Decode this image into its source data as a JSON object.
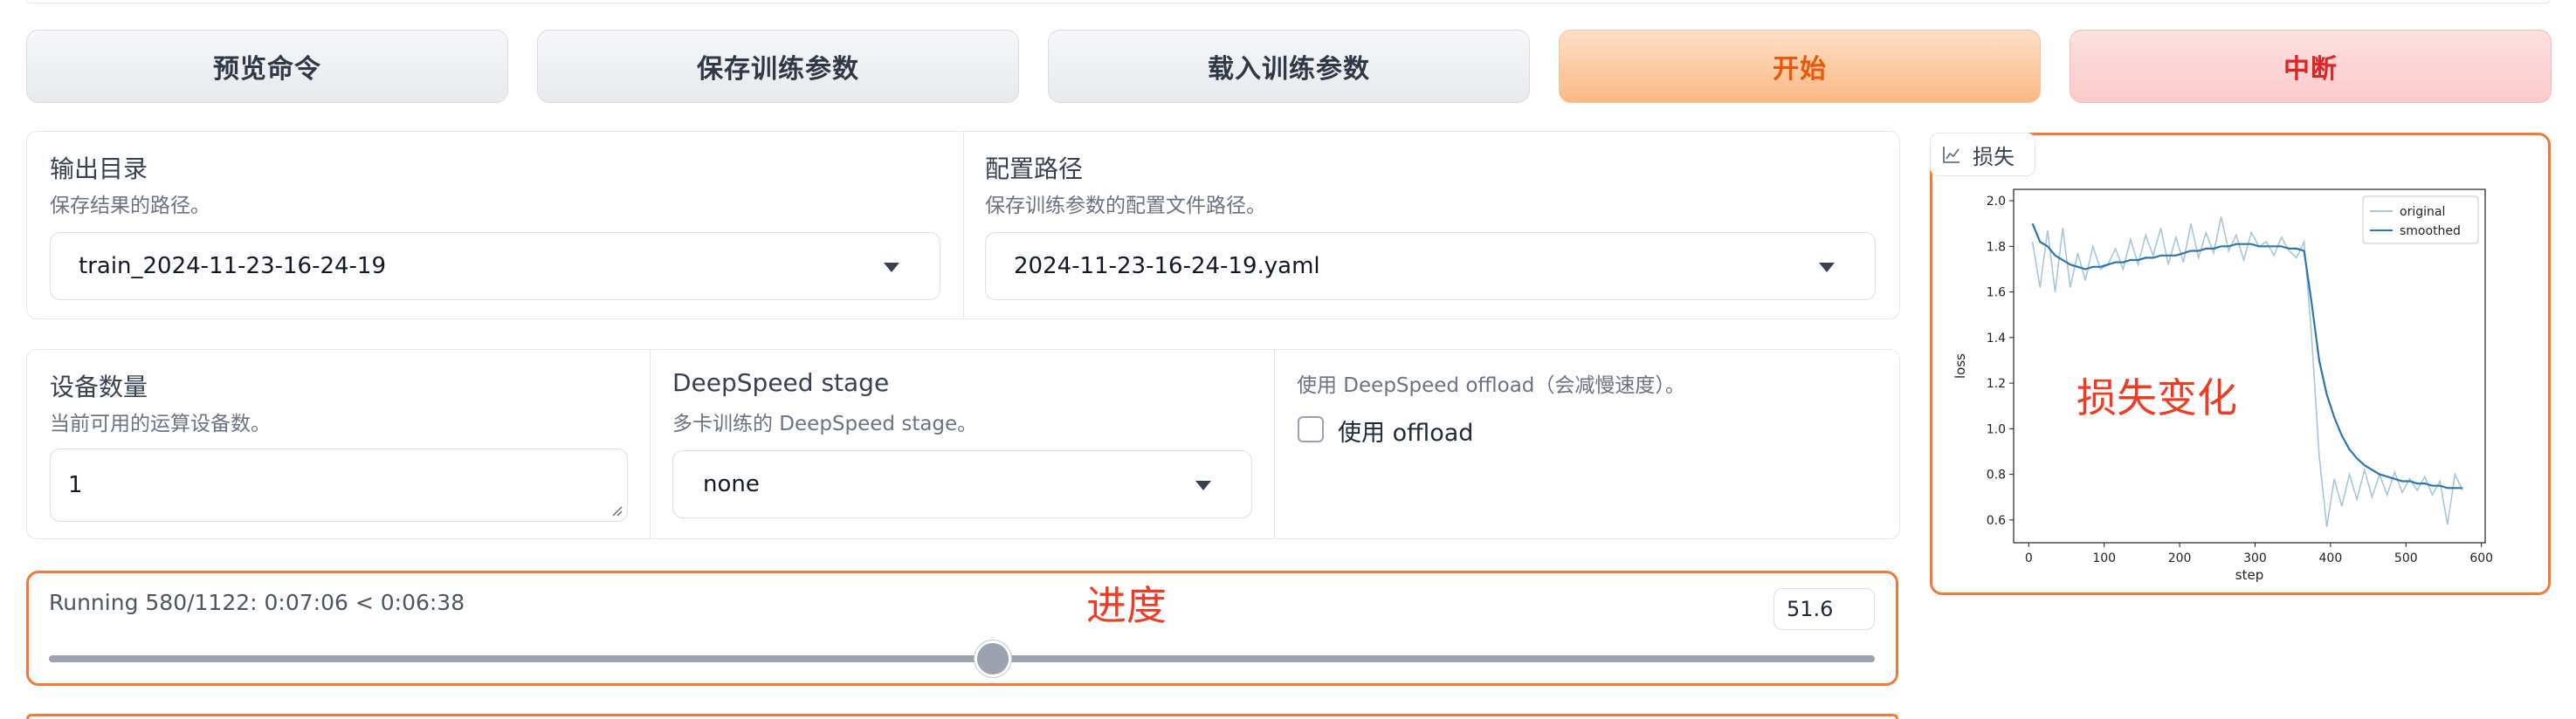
{
  "buttons": {
    "preview": "预览命令",
    "save_args": "保存训练参数",
    "load_args": "载入训练参数",
    "start": "开始",
    "abort": "中断"
  },
  "output_dir": {
    "label": "输出目录",
    "info": "保存结果的路径。",
    "value": "train_2024-11-23-16-24-19"
  },
  "config_path": {
    "label": "配置路径",
    "info": "保存训练参数的配置文件路径。",
    "value": "2024-11-23-16-24-19.yaml"
  },
  "device_count": {
    "label": "设备数量",
    "info": "当前可用的运算设备数。",
    "value": "1"
  },
  "ds_stage": {
    "label": "DeepSpeed stage",
    "info": "多卡训练的 DeepSpeed stage。",
    "value": "none"
  },
  "ds_offload": {
    "info": "使用 DeepSpeed offload（会减慢速度）。",
    "label": "使用 offload",
    "checked": false
  },
  "progress": {
    "text": "Running 580/1122: 0:07:06 < 0:06:38",
    "value_display": "51.6",
    "percent": 51.69,
    "annotation": "进度"
  },
  "loss_panel": {
    "tab_label": "损失",
    "annotation": "损失变化"
  },
  "chart_data": {
    "type": "line",
    "xlabel": "step",
    "ylabel": "loss",
    "xlim": [
      -20,
      605
    ],
    "ylim": [
      0.5,
      2.05
    ],
    "x_ticks": [
      0,
      100,
      200,
      300,
      400,
      500,
      600
    ],
    "y_ticks": [
      0.6,
      0.8,
      1.0,
      1.2,
      1.4,
      1.6,
      1.8,
      2.0
    ],
    "legend_position": "top-right",
    "series": [
      {
        "name": "original",
        "color": "#a9c6d9",
        "x": [
          5,
          15,
          25,
          35,
          45,
          55,
          65,
          75,
          85,
          95,
          105,
          115,
          125,
          135,
          145,
          155,
          165,
          175,
          185,
          195,
          205,
          215,
          225,
          235,
          245,
          255,
          265,
          275,
          285,
          295,
          305,
          315,
          325,
          335,
          345,
          355,
          365,
          375,
          385,
          395,
          405,
          415,
          425,
          435,
          445,
          455,
          465,
          475,
          485,
          495,
          505,
          515,
          525,
          535,
          545,
          555,
          565,
          575
        ],
        "y": [
          1.82,
          1.62,
          1.87,
          1.6,
          1.88,
          1.62,
          1.77,
          1.65,
          1.8,
          1.7,
          1.72,
          1.79,
          1.7,
          1.83,
          1.72,
          1.85,
          1.76,
          1.88,
          1.72,
          1.84,
          1.73,
          1.9,
          1.75,
          1.86,
          1.77,
          1.93,
          1.78,
          1.85,
          1.74,
          1.86,
          1.8,
          1.82,
          1.76,
          1.84,
          1.78,
          1.75,
          1.82,
          1.4,
          0.88,
          0.57,
          0.78,
          0.66,
          0.8,
          0.69,
          0.82,
          0.7,
          0.8,
          0.71,
          0.81,
          0.72,
          0.78,
          0.73,
          0.79,
          0.71,
          0.77,
          0.58,
          0.8,
          0.73
        ]
      },
      {
        "name": "smoothed",
        "color": "#2b76b0",
        "x": [
          5,
          15,
          25,
          35,
          45,
          55,
          65,
          75,
          85,
          95,
          105,
          115,
          125,
          135,
          145,
          155,
          165,
          175,
          185,
          195,
          205,
          215,
          225,
          235,
          245,
          255,
          265,
          275,
          285,
          295,
          305,
          315,
          325,
          335,
          345,
          355,
          365,
          375,
          385,
          395,
          405,
          415,
          425,
          435,
          445,
          455,
          465,
          475,
          485,
          495,
          505,
          515,
          525,
          535,
          545,
          555,
          565,
          575
        ],
        "y": [
          1.9,
          1.82,
          1.8,
          1.76,
          1.74,
          1.72,
          1.71,
          1.7,
          1.71,
          1.71,
          1.72,
          1.73,
          1.73,
          1.74,
          1.74,
          1.75,
          1.75,
          1.76,
          1.76,
          1.76,
          1.77,
          1.78,
          1.78,
          1.79,
          1.79,
          1.8,
          1.8,
          1.81,
          1.81,
          1.81,
          1.8,
          1.8,
          1.8,
          1.8,
          1.79,
          1.79,
          1.78,
          1.55,
          1.3,
          1.15,
          1.05,
          0.97,
          0.91,
          0.87,
          0.84,
          0.82,
          0.8,
          0.79,
          0.78,
          0.77,
          0.77,
          0.76,
          0.76,
          0.75,
          0.75,
          0.74,
          0.74,
          0.74
        ]
      }
    ]
  }
}
